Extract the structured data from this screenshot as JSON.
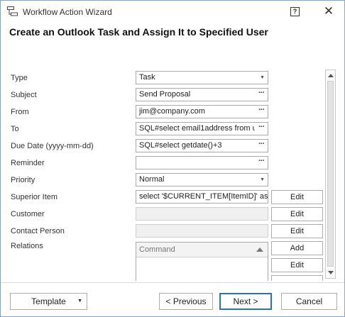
{
  "window": {
    "title": "Workflow Action Wizard",
    "help_label": "?",
    "close_label": "✕"
  },
  "heading": "Create an Outlook Task and Assign It to Specified User",
  "form": {
    "type": {
      "label": "Type",
      "value": "Task"
    },
    "subject": {
      "label": "Subject",
      "value": "Send Proposal"
    },
    "from": {
      "label": "From",
      "value": "jim@company.com"
    },
    "to": {
      "label": "To",
      "value": "SQL#select email1address from us"
    },
    "due_date": {
      "label": "Due Date (yyyy-mm-dd)",
      "value": "SQL#select getdate()+3"
    },
    "reminder": {
      "label": "Reminder",
      "value": ""
    },
    "priority": {
      "label": "Priority",
      "value": "Normal"
    },
    "superior_item": {
      "label": "Superior Item",
      "value": "select '$CURRENT_ITEM[ItemID]' as I"
    },
    "customer": {
      "label": "Customer",
      "value": ""
    },
    "contact_person": {
      "label": "Contact Person",
      "value": ""
    },
    "relations": {
      "label": "Relations",
      "column_header": "Command"
    }
  },
  "buttons": {
    "ellipsis": "···",
    "edit": "Edit",
    "add": "Add",
    "template": "Template",
    "previous": "< Previous",
    "next": "Next >",
    "cancel": "Cancel"
  },
  "icons": {
    "app": "workflow-icon",
    "dropdown": "chevron-down-icon",
    "sort": "sort-up-icon"
  }
}
